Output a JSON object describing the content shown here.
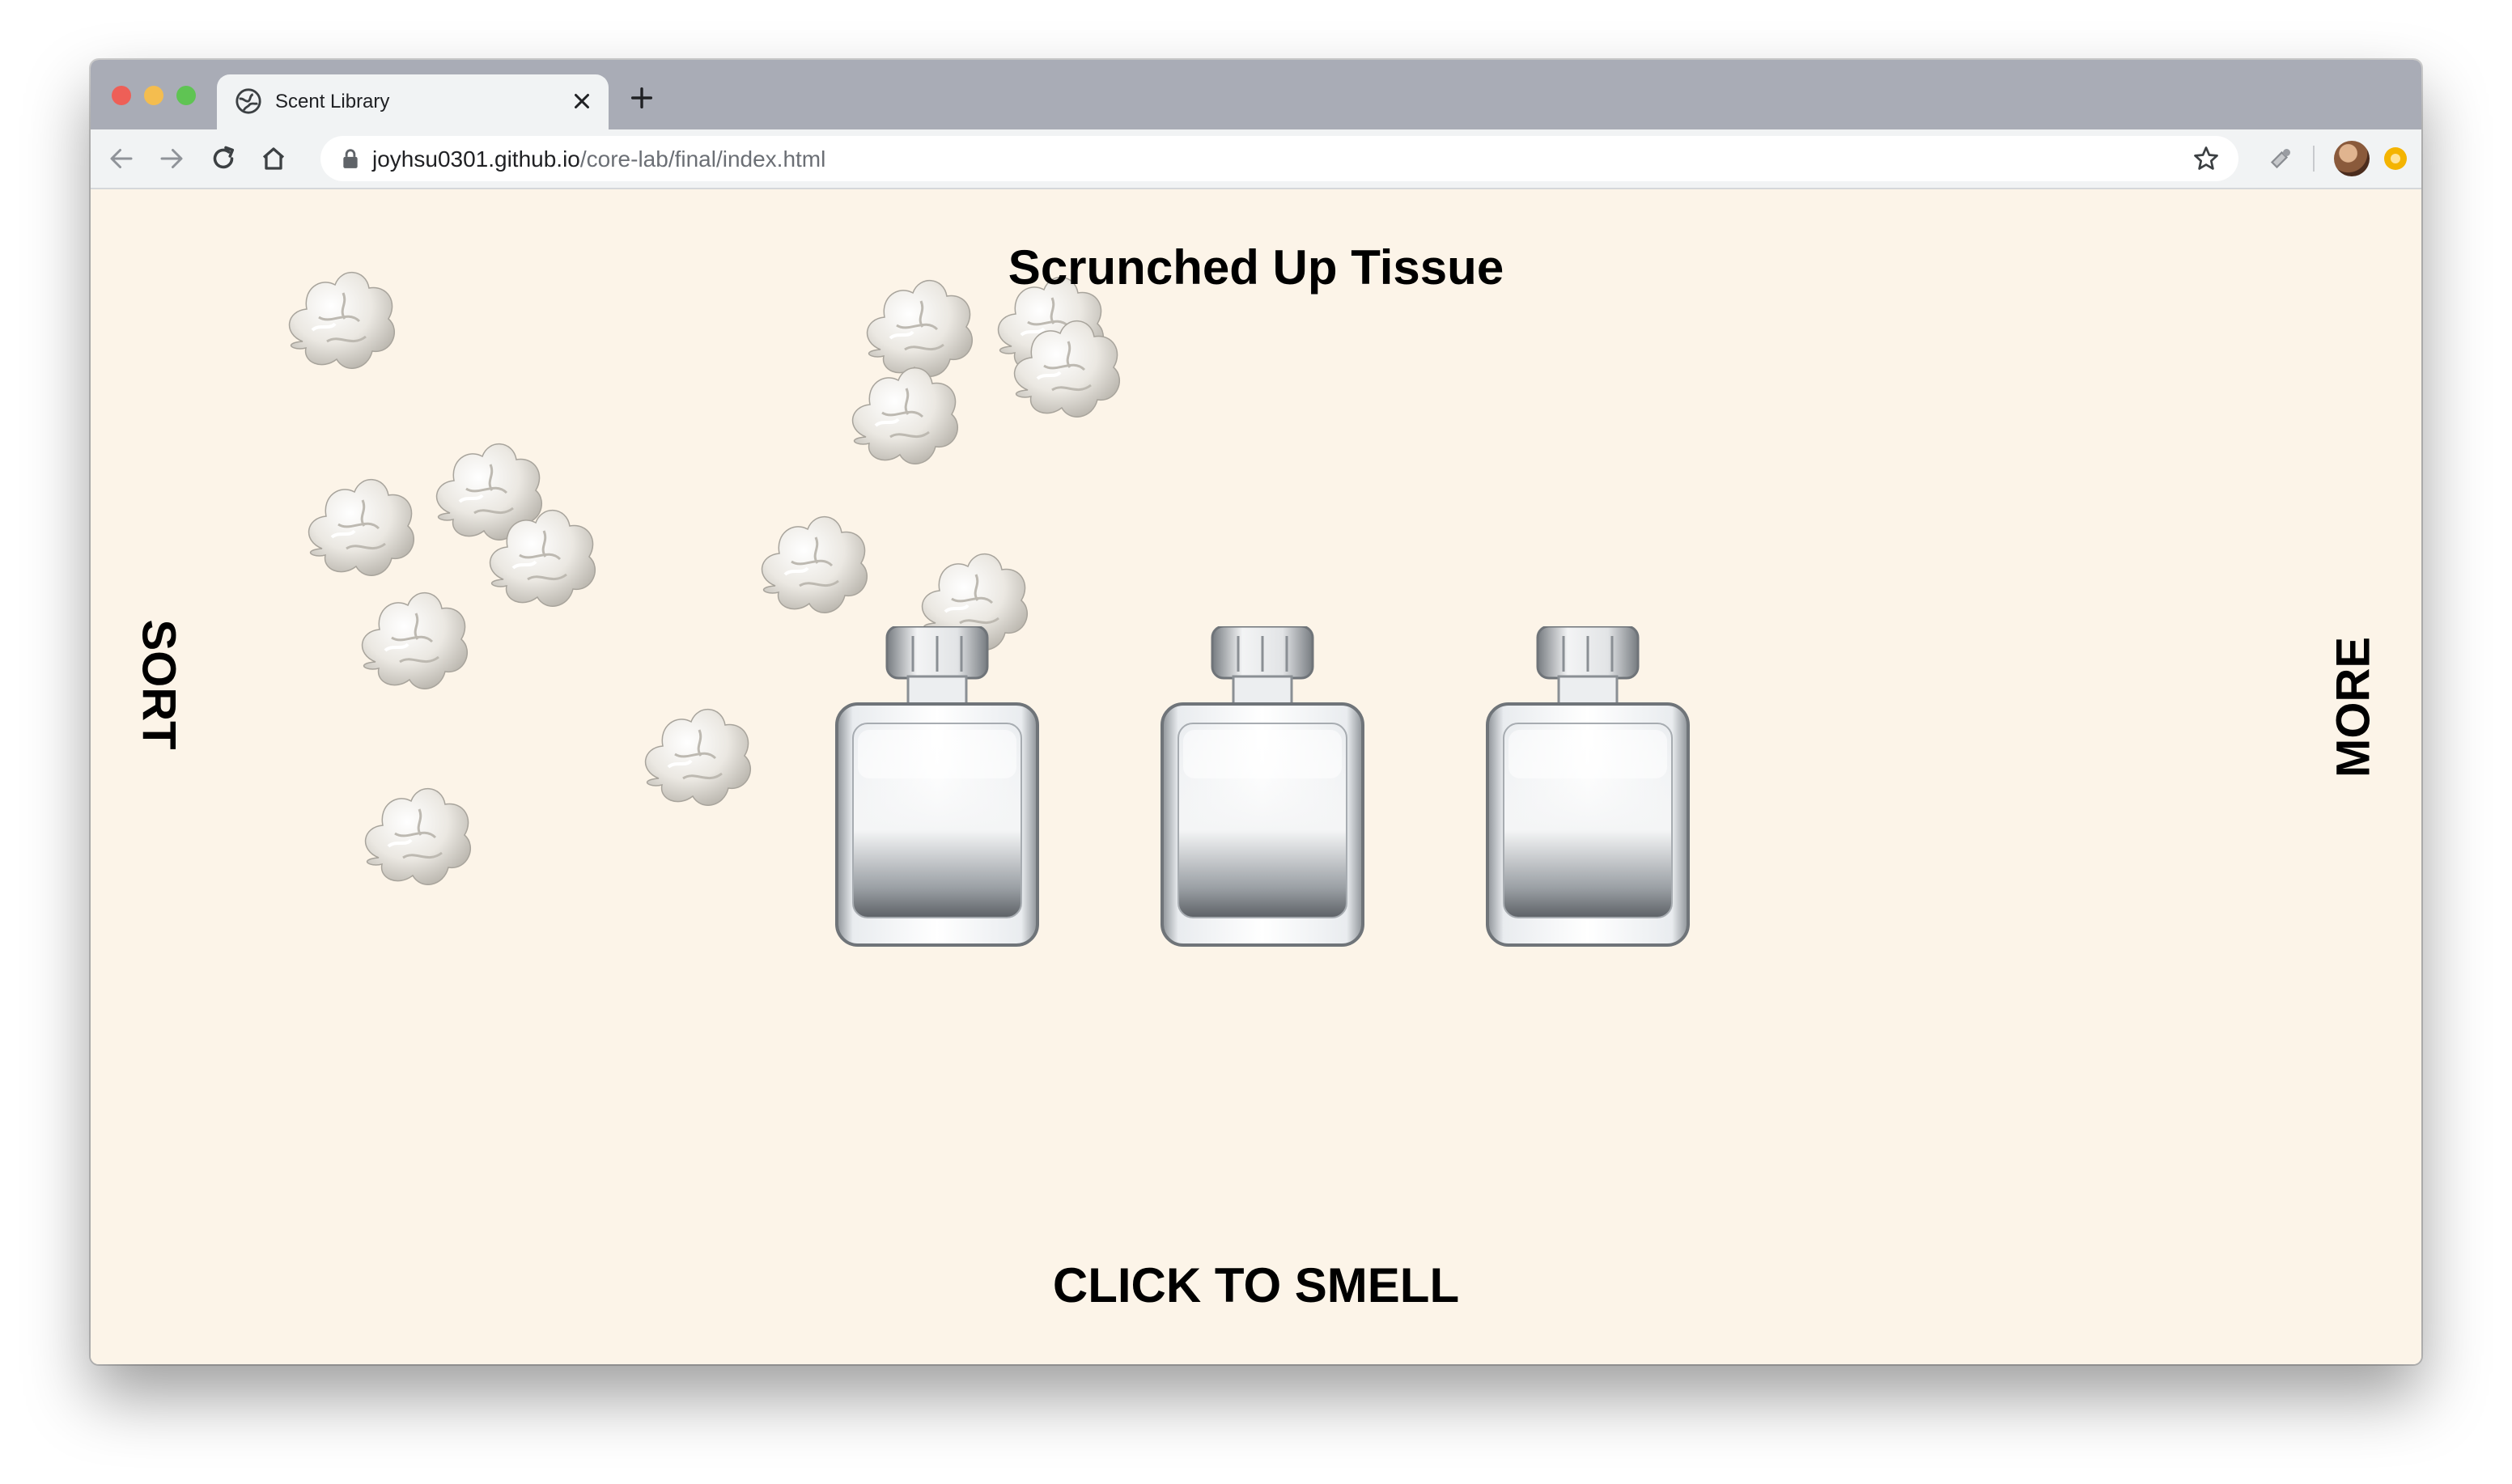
{
  "browser": {
    "tab_title": "Scent Library",
    "url_host": "joyhsu0301.github.io",
    "url_path": "/core-lab/final/index.html"
  },
  "page": {
    "title": "Scrunched Up Tissue",
    "sort_label": "SORT",
    "more_label": "MORE",
    "cta_label": "CLICK TO SMELL",
    "background_color": "#fcf4e8",
    "bottles": [
      "perfume-bottle",
      "perfume-bottle",
      "perfume-bottle"
    ],
    "decor_icon": "scrunched-tissue"
  }
}
